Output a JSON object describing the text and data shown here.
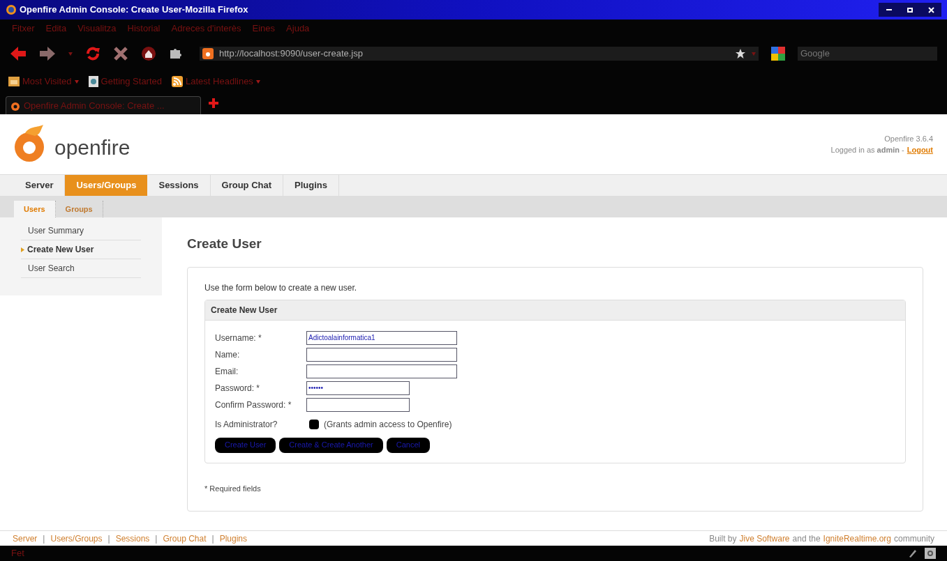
{
  "window": {
    "title": "Openfire Admin Console: Create User-Mozilla Firefox"
  },
  "menu": [
    "Fitxer",
    "Edita",
    "Visualitza",
    "Historial",
    "Adreces d'interès",
    "Eines",
    "Ajuda"
  ],
  "address_bar": {
    "value": "http://localhost:9090/user-create.jsp"
  },
  "search_field": {
    "placeholder": "Google"
  },
  "bookmarks": [
    {
      "label": "Most Visited",
      "kind": "folder",
      "dropdown": true
    },
    {
      "label": "Getting Started",
      "kind": "page",
      "dropdown": false
    },
    {
      "label": "Latest Headlines",
      "kind": "feed",
      "dropdown": true
    }
  ],
  "browser_tabs": [
    {
      "label": "Openfire Admin Console: Create ...",
      "selected": true
    }
  ],
  "header": {
    "logo_text": "openfire",
    "version": "Openfire 3.6.4",
    "login": "Logged in as **admin** -",
    "logout": "Logout"
  },
  "nav_tabs": [
    {
      "label": "Server",
      "selected": false
    },
    {
      "label": "Users/Groups",
      "selected": true
    },
    {
      "label": "Sessions",
      "selected": false
    },
    {
      "label": "Group Chat",
      "selected": false
    },
    {
      "label": "Plugins",
      "selected": false
    }
  ],
  "sub_tabs": [
    {
      "label": "Users",
      "selected": true
    },
    {
      "label": "Groups",
      "selected": false
    }
  ],
  "sidebar": {
    "items": [
      {
        "label": "User Summary",
        "selected": false
      },
      {
        "label": "Create New User",
        "selected": true
      },
      {
        "label": "User Search",
        "selected": false
      }
    ]
  },
  "content": {
    "title": "Create User",
    "intro": "Use the form below to create a new user.",
    "form": {
      "title": "Create New User",
      "fields": [
        {
          "label": "Username: *",
          "kind": "text",
          "value": "Adictoalainformatica1"
        },
        {
          "label": "Name:",
          "kind": "text"
        },
        {
          "label": "Email:",
          "kind": "text"
        },
        {
          "label": "Password: *",
          "kind": "password",
          "value": "••••••"
        },
        {
          "label": "Confirm Password: *",
          "kind": "password"
        },
        {
          "label": "Is Administrator?",
          "kind": "checkbox",
          "checked": false,
          "note": "(Grants admin access to Openfire)"
        }
      ],
      "buttons": [
        "Create User",
        "Create & Create Another",
        "Cancel"
      ]
    },
    "required_note": "* Required fields"
  },
  "footer": {
    "separator": "|",
    "links": [
      "Server",
      "Users/Groups",
      "Sessions",
      "Group Chat",
      "Plugins"
    ],
    "credit": [
      {
        "text": "Built by",
        "link": false
      },
      {
        "text": "Jive Software",
        "link": true
      },
      {
        "text": "and the",
        "link": false
      },
      {
        "text": "IgniteRealtime.org",
        "link": true
      },
      {
        "text": "community",
        "link": false
      }
    ]
  },
  "status_bar": {
    "text": "Fet"
  }
}
